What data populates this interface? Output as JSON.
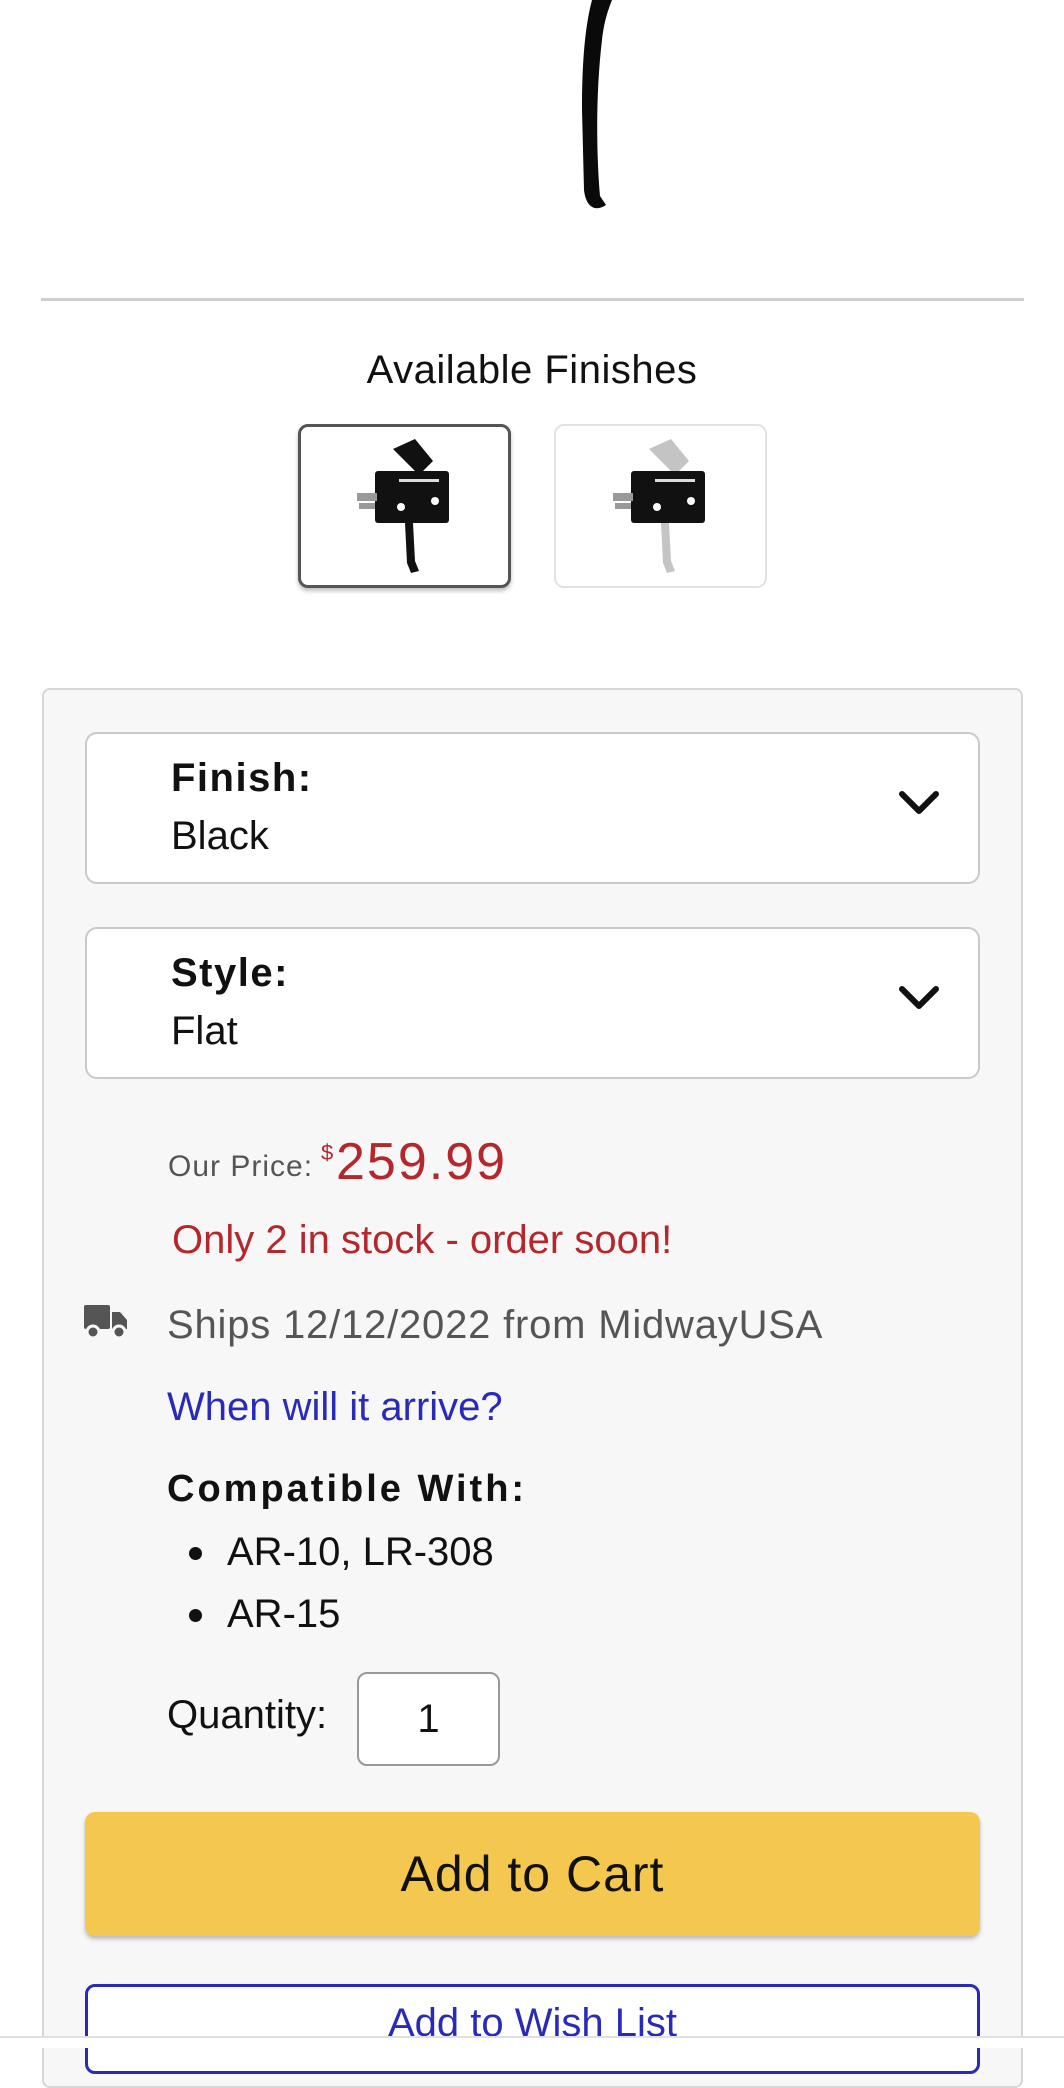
{
  "finishes": {
    "title": "Available Finishes",
    "options": [
      {
        "name": "Black",
        "selected": true,
        "trigger_color": "#111111"
      },
      {
        "name": "Silver",
        "selected": false,
        "trigger_color": "#c4c4c4"
      }
    ]
  },
  "selectors": {
    "finish": {
      "label": "Finish:",
      "value": "Black"
    },
    "style": {
      "label": "Style:",
      "value": "Flat"
    }
  },
  "price": {
    "label": "Our Price:",
    "currency": "$",
    "amount": "259.99"
  },
  "stock_message": "Only 2 in stock - order soon!",
  "shipping": {
    "icon": "truck-icon",
    "text": "Ships 12/12/2022 from MidwayUSA"
  },
  "arrival_link": "When will it arrive?",
  "compatibility": {
    "title": "Compatible With:",
    "items": [
      "AR-10, LR-308",
      "AR-15"
    ]
  },
  "quantity": {
    "label": "Quantity:",
    "value": "1"
  },
  "buttons": {
    "add_to_cart": "Add to Cart",
    "add_to_wish_list": "Add to Wish List"
  },
  "colors": {
    "price_red": "#b3282d",
    "link_blue": "#2a2ab8",
    "cart_yellow": "#f4c84f"
  }
}
